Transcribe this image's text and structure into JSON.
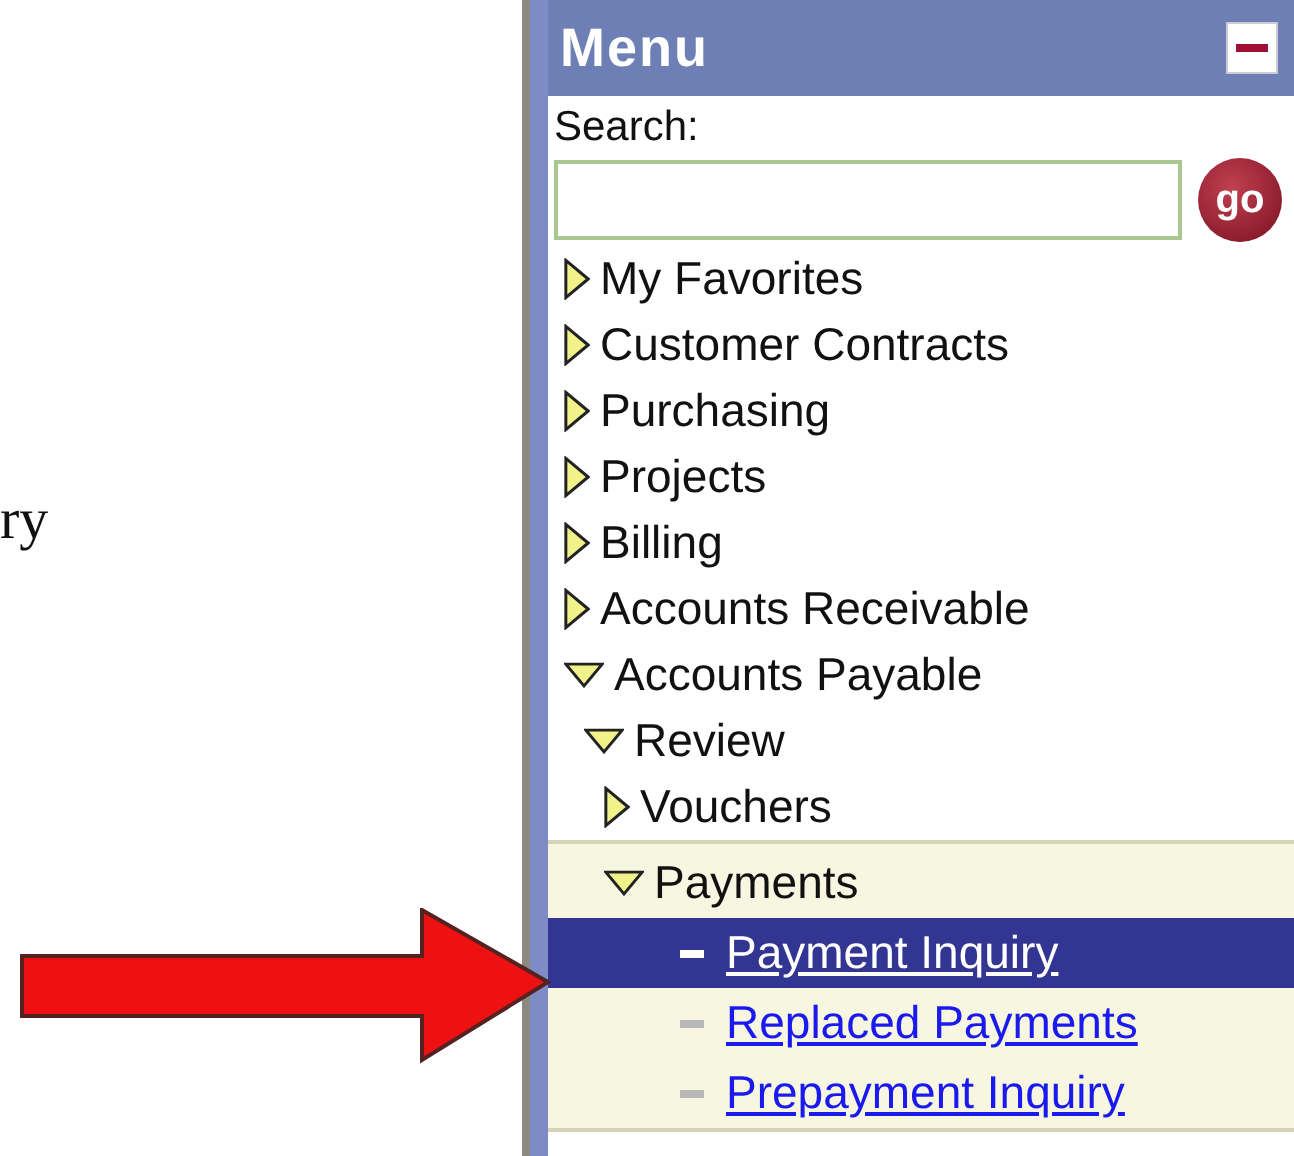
{
  "document_text": "ry",
  "menu": {
    "title": "Menu",
    "search": {
      "label": "Search:",
      "button": "go"
    },
    "items": [
      {
        "label": "My Favorites",
        "kind": "folder",
        "expanded": false,
        "selected": false
      },
      {
        "label": "Customer Contracts",
        "kind": "folder",
        "expanded": false,
        "selected": false
      },
      {
        "label": "Purchasing",
        "kind": "folder",
        "expanded": false,
        "selected": false
      },
      {
        "label": "Projects",
        "kind": "folder",
        "expanded": false,
        "selected": false
      },
      {
        "label": "Billing",
        "kind": "folder",
        "expanded": false,
        "selected": false
      },
      {
        "label": "Accounts Receivable",
        "kind": "folder",
        "expanded": false,
        "selected": false
      },
      {
        "label": "Accounts Payable",
        "kind": "folder",
        "expanded": true,
        "selected": false,
        "children": [
          {
            "label": "Review",
            "kind": "folder",
            "expanded": true,
            "selected": false,
            "children": [
              {
                "label": "Vouchers",
                "kind": "folder",
                "expanded": false,
                "selected": false
              },
              {
                "label": "Payments",
                "kind": "folder",
                "expanded": true,
                "selected": false,
                "children": [
                  {
                    "label": "Payment Inquiry",
                    "kind": "link",
                    "selected": true
                  },
                  {
                    "label": "Replaced Payments",
                    "kind": "link",
                    "selected": false
                  },
                  {
                    "label": "Prepayment Inquiry",
                    "kind": "link",
                    "selected": false
                  }
                ]
              }
            ]
          }
        ]
      }
    ]
  }
}
